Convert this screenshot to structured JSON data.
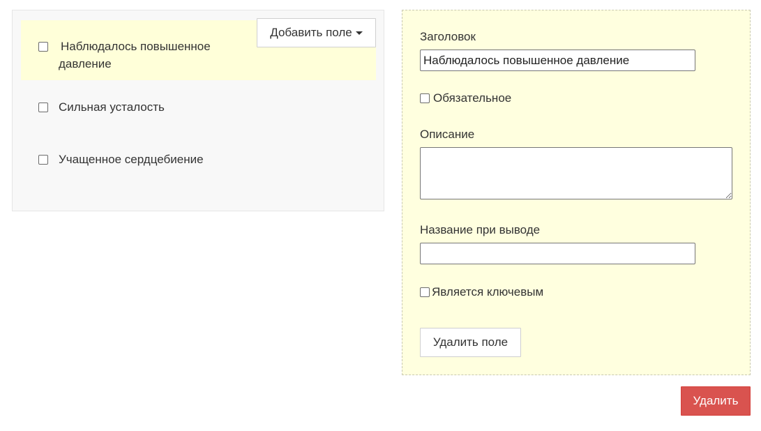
{
  "fields_list": {
    "add_field_label": "Добавить поле",
    "items": [
      {
        "label": "Наблюдалось повышенное давление",
        "checked": false,
        "selected": true
      },
      {
        "label": "Сильная усталость",
        "checked": false,
        "selected": false
      },
      {
        "label": "Учащенное сердцебиение",
        "checked": false,
        "selected": false
      }
    ]
  },
  "editor": {
    "title_label": "Заголовок",
    "title_value": "Наблюдалось повышенное давление",
    "required_label": "Обязательное",
    "description_label": "Описание",
    "description_value": "",
    "output_name_label": "Название при выводе",
    "output_name_value": "",
    "key_label": "Является ключевым",
    "remove_field_label": "Удалить поле"
  },
  "actions": {
    "delete_label": "Удалить"
  },
  "colors": {
    "selected_item_bg": "#ffffd9",
    "editor_bg": "#ffffdf",
    "delete_bg": "#d9534f"
  },
  "icons": {
    "dropdown": "caret-down-icon"
  }
}
